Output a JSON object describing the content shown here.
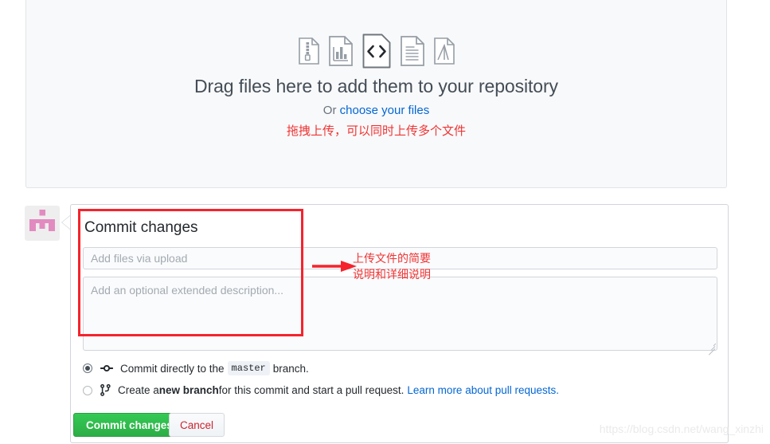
{
  "dropzone": {
    "title": "Drag files here to add them to your repository",
    "or_label": "Or ",
    "choose_link": "choose your files",
    "annotation_note": "拖拽上传，可以同时上传多个文件",
    "file_icons": [
      {
        "name": "zip-file-icon",
        "label": "zip"
      },
      {
        "name": "chart-file-icon",
        "label": "chart"
      },
      {
        "name": "code-file-icon",
        "label": "code"
      },
      {
        "name": "text-file-icon",
        "label": "text"
      },
      {
        "name": "pdf-file-icon",
        "label": "pdf"
      }
    ]
  },
  "commit": {
    "heading": "Commit changes",
    "summary_placeholder": "Add files via upload",
    "summary_value": "",
    "description_placeholder": "Add an optional extended description...",
    "description_value": "",
    "options": [
      {
        "id": "commit-direct",
        "icon": "git-commit-icon",
        "selected": true,
        "text_before": "Commit directly to the",
        "branch": "master",
        "text_after": "branch."
      },
      {
        "id": "create-branch",
        "icon": "git-branch-icon",
        "selected": false,
        "text_before": "Create a ",
        "emphasis": "new branch",
        "text_after": " for this commit and start a pull request.",
        "link": "Learn more about pull requests."
      }
    ],
    "commit_button": "Commit changes",
    "cancel_button": "Cancel"
  },
  "annotations": {
    "field_note": "上传文件的简要\n说明和详细说明"
  },
  "watermark": "https://blog.csdn.net/wang_xinzhi",
  "colors": {
    "link": "#0366d6",
    "annotation_red": "#f03434",
    "annotation_box_red": "#f5232d",
    "commit_green": "#2cad46",
    "cancel_red": "#cb2431",
    "avatar_pink": "#e28bc0"
  }
}
